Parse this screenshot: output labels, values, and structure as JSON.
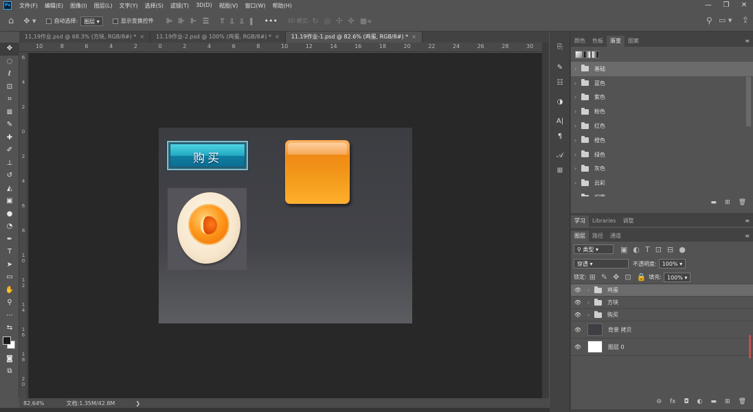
{
  "app": {
    "logo": "Ps"
  },
  "menu": [
    "文件(F)",
    "编辑(E)",
    "图像(I)",
    "图层(L)",
    "文字(Y)",
    "选择(S)",
    "滤镜(T)",
    "3D(D)",
    "视图(V)",
    "窗口(W)",
    "帮助(H)"
  ],
  "window_controls": {
    "minimize": "—",
    "restore": "❐",
    "close": "✕"
  },
  "options": {
    "auto_select_label": "自动选择:",
    "auto_select_value": "图层",
    "show_transform_label": "显示变换控件",
    "mode_3d_label": "3D 模式:",
    "more": "•••"
  },
  "tabs": [
    {
      "label": "11,19作业.psd @ 68.3% (方块, RGB/8#) *",
      "close": "×"
    },
    {
      "label": "11.19作业-2.psd @ 100% (鸡蛋, RGB/8#) *",
      "close": "×"
    },
    {
      "label": "11.19作业-1.psd @ 82.6% (鸡蛋, RGB/8#) *",
      "close": "×"
    }
  ],
  "ruler_top": [
    "10",
    "8",
    "6",
    "4",
    "2",
    "0",
    "2",
    "4",
    "6",
    "8",
    "10",
    "12",
    "14",
    "16",
    "18",
    "20",
    "22",
    "24",
    "26",
    "28",
    "30"
  ],
  "ruler_left": [
    "6",
    "4",
    "2",
    "0",
    "2",
    "4",
    "6",
    "8",
    "1\n0",
    "1\n2",
    "1\n4",
    "1\n6",
    "1\n8",
    "2\n0"
  ],
  "canvas": {
    "buy_label": "购买"
  },
  "swatches_panel": {
    "tabs": [
      "颜色",
      "色板",
      "渐变",
      "图案"
    ],
    "active_tab": "渐变",
    "menu": "≡",
    "presets": [
      "基础",
      "蓝色",
      "紫色",
      "粉色",
      "红色",
      "橙色",
      "绿色",
      "灰色",
      "云彩",
      "烟雾"
    ],
    "footer": [
      "▬",
      "⊞",
      "🗑"
    ]
  },
  "learn_panel": {
    "tabs": [
      "学习",
      "Libraries",
      "调整"
    ],
    "menu": "≡"
  },
  "layers_panel": {
    "tabs": [
      "图层",
      "路径",
      "通道"
    ],
    "menu": "≡",
    "filter_label": "类型",
    "blend_mode": "穿透",
    "opacity_label": "不透明度:",
    "opacity_value": "100%",
    "lock_label": "锁定:",
    "fill_label": "填充:",
    "fill_value": "100%",
    "layers": [
      {
        "name": "鸡蛋",
        "type": "group",
        "selected": true
      },
      {
        "name": "方块",
        "type": "group",
        "selected": false
      },
      {
        "name": "购买",
        "type": "group",
        "selected": false
      },
      {
        "name": "背景 拷贝",
        "type": "dark",
        "selected": false
      },
      {
        "name": "图层 0",
        "type": "white",
        "selected": false
      }
    ],
    "footer": [
      "⊖",
      "fx",
      "◘",
      "◐",
      "▬",
      "⊞",
      "🗑"
    ]
  },
  "status": {
    "zoom": "82.64%",
    "doc": "文档:1.35M/42.8M",
    "arrow": "❯"
  },
  "colors": {
    "accent_blue": "#31a8ff",
    "orange": "#f39a1c",
    "teal": "#1ea6be"
  }
}
